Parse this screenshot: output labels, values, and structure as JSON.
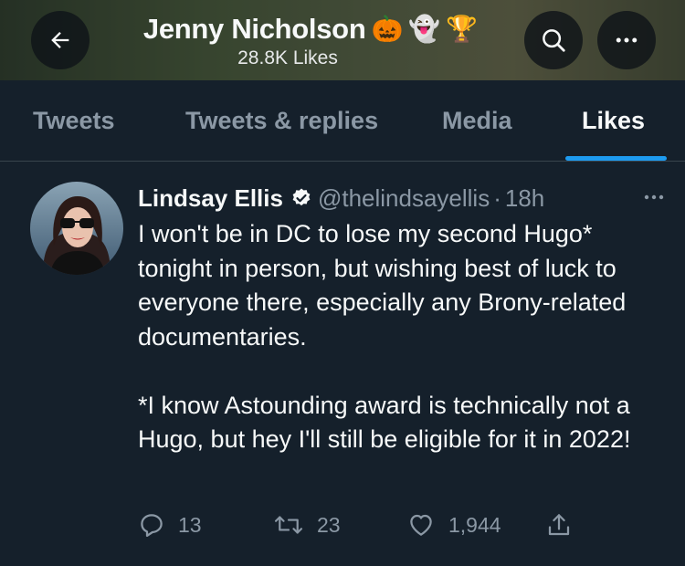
{
  "header": {
    "name": "Jenny Nicholson",
    "name_emojis": [
      "🎃",
      "👻",
      "🏆"
    ],
    "likes_count": "28.8K Likes",
    "back_icon": "arrow-left-icon",
    "search_icon": "search-icon",
    "more_icon": "more-horizontal-icon"
  },
  "tabs": [
    {
      "label": "Tweets",
      "active": false
    },
    {
      "label": "Tweets & replies",
      "active": false
    },
    {
      "label": "Media",
      "active": false
    },
    {
      "label": "Likes",
      "active": true
    }
  ],
  "tweet": {
    "author": "Lindsay Ellis",
    "verified": true,
    "handle": "@thelindsayellis",
    "separator": "·",
    "time": "18h",
    "paragraph1": "I won't be in DC to lose my second Hugo* tonight in person, but wishing best of luck to everyone there, especially any Brony-related documentaries.",
    "paragraph2": "*I know Astounding award is technically not a Hugo, but hey I'll still be eligible for it in 2022!",
    "replies": "13",
    "retweets": "23",
    "likes": "1,944"
  },
  "colors": {
    "background": "#15202b",
    "accent": "#1d9bf0",
    "muted_text": "#8b98a5",
    "divider": "#38444d"
  }
}
